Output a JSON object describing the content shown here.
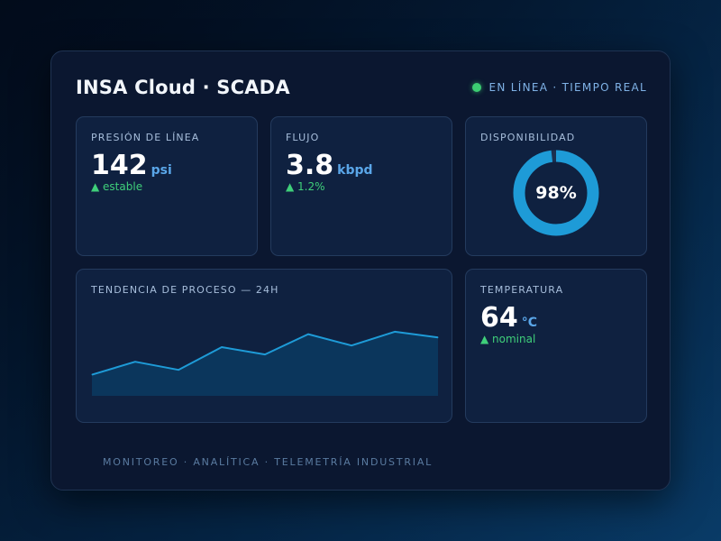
{
  "header": {
    "title": "INSA Cloud · SCADA",
    "status": "EN LÍNEA · TIEMPO REAL"
  },
  "colors": {
    "accent": "#1e9bd7",
    "status_online": "#3ccd72",
    "trend_up": "#3fcf7a"
  },
  "cards": {
    "pressure": {
      "label": "PRESIÓN DE LÍNEA",
      "value": "142",
      "unit": "psi",
      "trend": "▲ estable"
    },
    "flow": {
      "label": "FLUJO",
      "value": "3.8",
      "unit": "kbpd",
      "trend": "▲ 1.2%"
    },
    "availability": {
      "label": "DISPONIBILIDAD",
      "value_text": "98%",
      "percent": 98
    },
    "trend_chart": {
      "label": "TENDENCIA DE PROCESO — 24H"
    },
    "temperature": {
      "label": "TEMPERATURA",
      "value": "64",
      "unit": "°C",
      "trend": "▲ nominal"
    }
  },
  "footer": "MONITOREO · ANALÍTICA · TELEMETRÍA INDUSTRIAL",
  "chart_data": {
    "type": "area",
    "title": "TENDENCIA DE PROCESO — 24H",
    "xlabel": "",
    "ylabel": "",
    "x": [
      0,
      1,
      2,
      3,
      4,
      5,
      6,
      7,
      8
    ],
    "series": [
      {
        "values": [
          26,
          42,
          32,
          60,
          51,
          76,
          62,
          79,
          72
        ]
      }
    ],
    "ylim": [
      0,
      100
    ],
    "grid": false
  }
}
